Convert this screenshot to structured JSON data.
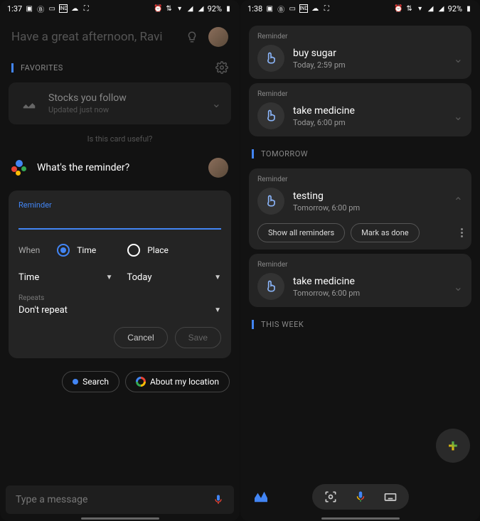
{
  "left": {
    "status": {
      "time": "1:37",
      "battery": "92%",
      "carrier": "IND"
    },
    "greeting": "Have a great afternoon, Ravi",
    "favorites_header": "FAVORITES",
    "stocks": {
      "title": "Stocks you follow",
      "subtitle": "Updated just now"
    },
    "card_feedback": "Is this card useful?",
    "assistant_question": "What's the reminder?",
    "reminder_form": {
      "label": "Reminder",
      "when_label": "When",
      "radio_time": "Time",
      "radio_place": "Place",
      "dd_time": "Time",
      "dd_day": "Today",
      "repeats_label": "Repeats",
      "repeats_value": "Don't repeat",
      "cancel": "Cancel",
      "save": "Save"
    },
    "suggestions": {
      "search": "Search",
      "location": "About my location"
    },
    "input_placeholder": "Type a message"
  },
  "right": {
    "status": {
      "time": "1:38",
      "battery": "92%",
      "carrier": "IND"
    },
    "reminders": [
      {
        "label": "Reminder",
        "title": "buy sugar",
        "time": "Today, 2:59 pm"
      },
      {
        "label": "Reminder",
        "title": "take medicine",
        "time": "Today, 6:00 pm"
      }
    ],
    "tomorrow_header": "TOMORROW",
    "tomorrow": [
      {
        "label": "Reminder",
        "title": "testing",
        "time": "Tomorrow, 6:00 pm",
        "expanded": true
      },
      {
        "label": "Reminder",
        "title": "take medicine",
        "time": "Tomorrow, 6:00 pm"
      }
    ],
    "actions": {
      "show_all": "Show all reminders",
      "mark_done": "Mark as done"
    },
    "this_week_header": "THIS WEEK"
  }
}
